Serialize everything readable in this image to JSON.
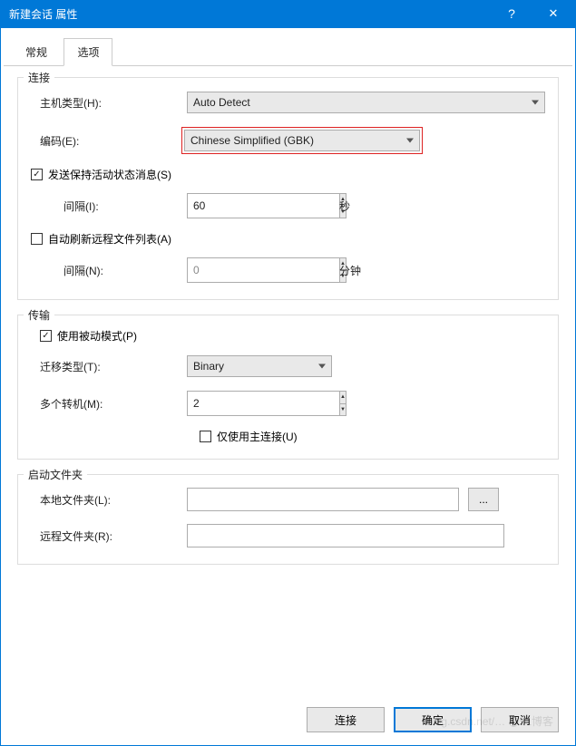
{
  "window": {
    "title": "新建会话 属性",
    "help": "?",
    "close": "✕"
  },
  "tabs": {
    "general": "常规",
    "options": "选项"
  },
  "groups": {
    "connection": {
      "legend": "连接",
      "host_type_label": "主机类型(H):",
      "host_type_value": "Auto Detect",
      "encoding_label": "编码(E):",
      "encoding_value": "Chinese Simplified (GBK)",
      "keepalive_label": "发送保持活动状态消息(S)",
      "keepalive_checked": true,
      "interval1_label": "间隔(I):",
      "interval1_value": "60",
      "interval1_unit": "秒",
      "autorefresh_label": "自动刷新远程文件列表(A)",
      "autorefresh_checked": false,
      "interval2_label": "间隔(N):",
      "interval2_value": "0",
      "interval2_unit": "分钟"
    },
    "transfer": {
      "legend": "传输",
      "passive_label": "使用被动模式(P)",
      "passive_checked": true,
      "type_label": "迁移类型(T):",
      "type_value": "Binary",
      "multi_label": "多个转机(M):",
      "multi_value": "2",
      "mainconn_label": "仅使用主连接(U)",
      "mainconn_checked": false
    },
    "startup": {
      "legend": "启动文件夹",
      "local_label": "本地文件夹(L):",
      "local_value": "",
      "browse": "...",
      "remote_label": "远程文件夹(R):",
      "remote_value": ""
    }
  },
  "footer": {
    "connect": "连接",
    "ok": "确定",
    "cancel": "取消"
  },
  "watermark": "blog.csdn.net/… @51博客"
}
